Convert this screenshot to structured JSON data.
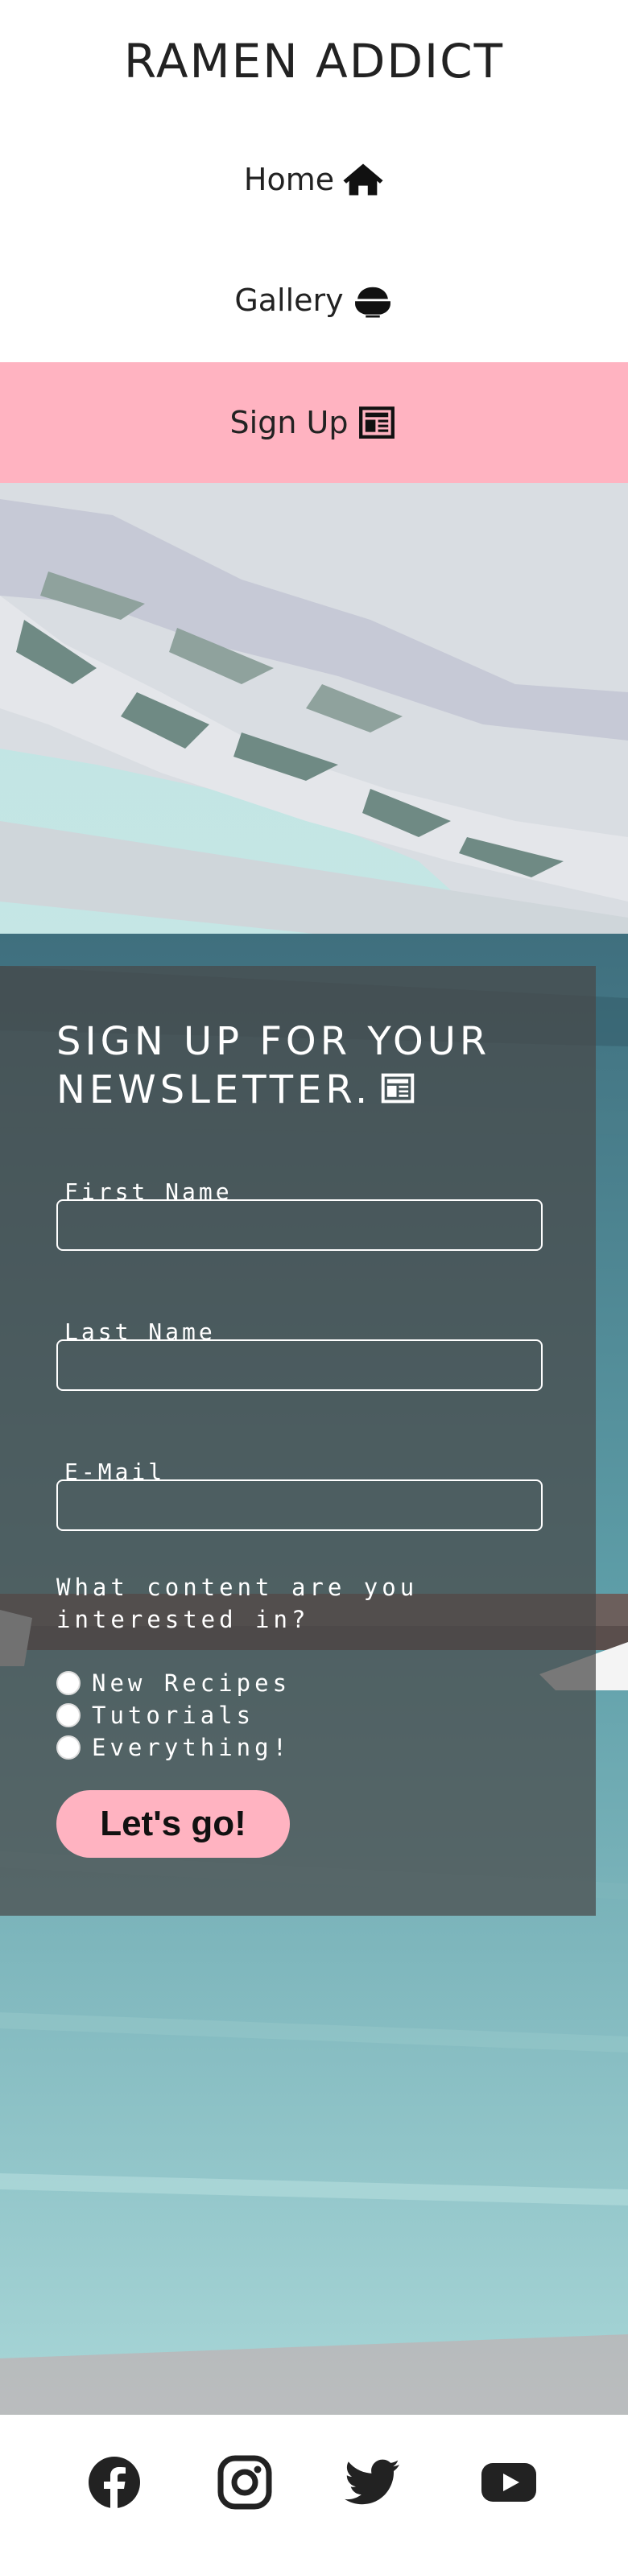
{
  "header": {
    "brand": "RAMEN ADDICT",
    "nav": [
      {
        "label": "Home",
        "icon": "home-icon"
      },
      {
        "label": "Gallery",
        "icon": "bowl-icon"
      },
      {
        "label": "Sign Up",
        "icon": "newspaper-icon",
        "active": true
      }
    ]
  },
  "colors": {
    "accent": "#ffb3c1",
    "panel": "#484848",
    "text_dark": "#222222"
  },
  "form": {
    "title": "SIGN UP FOR YOUR NEWSLETTER.",
    "title_icon": "newspaper-icon",
    "fields": [
      {
        "label": "First Name",
        "value": ""
      },
      {
        "label": "Last Name",
        "value": ""
      },
      {
        "label": "E-Mail",
        "value": ""
      }
    ],
    "question": "What content are you interested in?",
    "options": [
      "New Recipes",
      "Tutorials",
      "Everything!"
    ],
    "submit_label": "Let's go!"
  },
  "footer": {
    "social": [
      "facebook-icon",
      "instagram-icon",
      "twitter-icon",
      "youtube-icon"
    ]
  }
}
